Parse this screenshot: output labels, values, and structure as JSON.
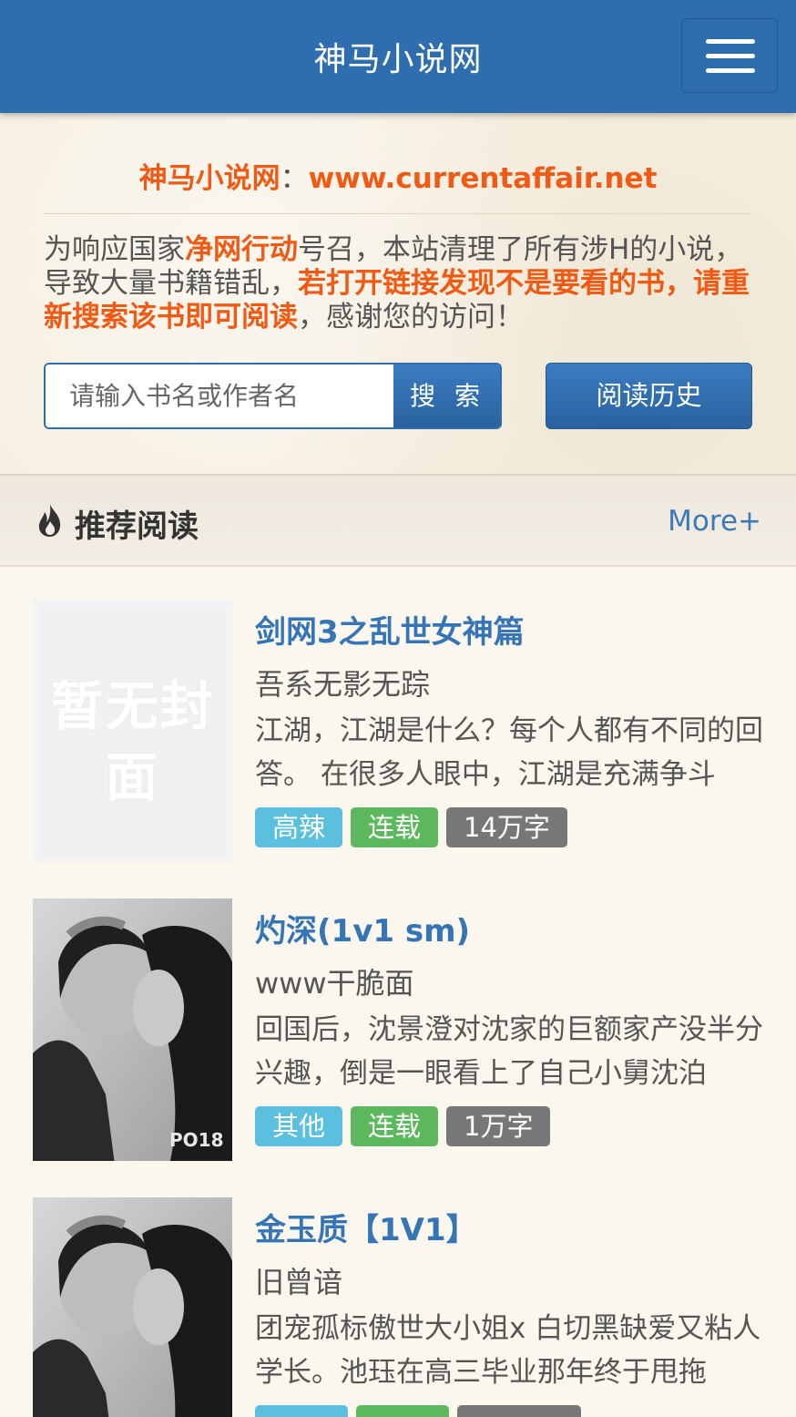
{
  "header": {
    "site_title": "神马小说网",
    "menu_icon": "hamburger-menu-icon"
  },
  "notice": {
    "site_name": "神马小说网",
    "separator": "：",
    "site_url": "www.currentaffair.net",
    "text_1": "为响应国家",
    "text_2": "净网行动",
    "text_3": "号召，本站清理了所有涉H的小说，导致大量书籍错乱，",
    "text_4": "若打开链接发现不是要看的书，请重新搜索该书即可阅读",
    "text_5": "，感谢您的访问！"
  },
  "search": {
    "placeholder": "请输入书名或作者名",
    "button_label": "搜 索",
    "history_label": "阅读历史"
  },
  "section": {
    "title": "推荐阅读",
    "more_label": "More+",
    "icon": "fire-icon"
  },
  "books": [
    {
      "title": "剑网3之乱世女神篇",
      "author": "吾系无影无踪",
      "description": "江湖，江湖是什么？每个人都有不同的回答。 在很多人眼中，江湖是充满争斗",
      "genre": "高辣",
      "status": "连载",
      "words": "14万字",
      "cover_text": "暂无封面"
    },
    {
      "title": "灼深(1v1 sm)",
      "author": "www干脆面",
      "description": "回国后，沈景澄对沈家的巨额家产没半分兴趣，倒是一眼看上了自己小舅沈泊",
      "genre": "其他",
      "status": "连载",
      "words": "1万字",
      "cover_text": "PO18"
    },
    {
      "title": "金玉质【1V1】",
      "author": "旧曾谙",
      "description": "团宠孤标傲世大小姐x 白切黑缺爱又粘人学长。池珏在高三毕业那年终于甩拖",
      "genre": "",
      "status": "",
      "words": "",
      "cover_text": ""
    }
  ],
  "colors": {
    "header_bg": "#2f6eae",
    "accent_orange": "#f05a14",
    "link_blue": "#3575b5",
    "tag_genre": "#5bc0de",
    "tag_status": "#5cb85c",
    "tag_words": "#777777"
  }
}
